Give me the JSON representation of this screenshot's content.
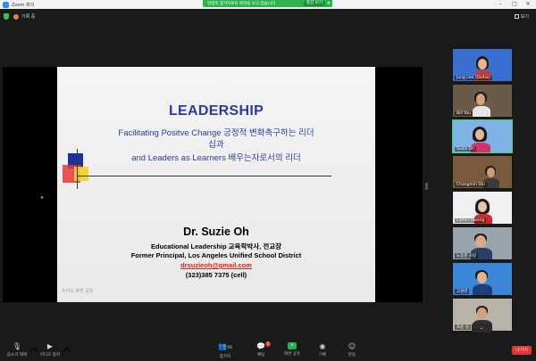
{
  "window": {
    "title": "Zoom 회의",
    "controls": [
      "–",
      "□",
      "✕"
    ]
  },
  "banner": {
    "text": "영업의 참가자로의 화면을 보고 있습니다",
    "button": "옵션 보기",
    "close": "✕"
  },
  "infobar": {
    "recording_label": "기록 중",
    "view_label": "보기"
  },
  "slide": {
    "title": "LEADERSHIP",
    "line1": "Facilitating Positve Change 긍정적 변화촉구하는 리더",
    "line2": "십과",
    "line3": "and Leaders as Learners 배우는자로서의 리더",
    "author": "Dr. Suzie Oh",
    "detail1": "Educational Leadership 교육학박사, 전교장",
    "detail2": "Former Principal, Los Angeles Unified School District",
    "email": "drsuzieoh@gmail.com",
    "phone": "(323)385 7375 (cell)",
    "presenter_tag": "수지오 화면 공유"
  },
  "gallery": {
    "tiles": [
      {
        "name": "Jung Lee (Dallas)",
        "active": false,
        "bg": "#3a6fd0",
        "skin": "#e9b48f",
        "hair": "#2a1a10",
        "shirt": "#c23a3a"
      },
      {
        "name": "Bill You",
        "active": false,
        "bg": "#6b5a4a",
        "skin": "#d8a27c",
        "hair": "#1e1e1e",
        "shirt": "#e6e6e6"
      },
      {
        "name": "Suzie Oh",
        "active": true,
        "bg": "#7fb3e6",
        "skin": "#e7b896",
        "hair": "#1a1a1a",
        "shirt": "#d6306a"
      },
      {
        "name": "Changmin Doi",
        "active": false,
        "bg": "#7a5a3c",
        "skin": "#cf9b76",
        "hair": "#202020",
        "shirt": "#3a3a3a"
      },
      {
        "name": "Esther Hwang",
        "active": false,
        "bg": "#f0f0f0",
        "skin": "#ecc3a3",
        "hair": "#1c1c1c",
        "shirt": "#d02a2a"
      },
      {
        "name": "노동준 사랑",
        "active": false,
        "bg": "#9aa3ad",
        "skin": "#d9aa86",
        "hair": "#1c1c1c",
        "shirt": "#2c3e66"
      },
      {
        "name": "고성란",
        "active": false,
        "bg": "#3c86d8",
        "skin": "#e3b291",
        "hair": "#1b1b1b",
        "shirt": "#1d3f7a"
      },
      {
        "name": "조윤 강",
        "active": false,
        "bg": "#b9b2a6",
        "skin": "#d3a07e",
        "hair": "#202020",
        "shirt": "#2f2f2f"
      }
    ],
    "more": "⌄"
  },
  "toolbar": {
    "mute": "음소거 해제",
    "video": "비디오 중지",
    "participants": "참가자",
    "participants_count": "40",
    "chat": "채팅",
    "chat_badge": "1",
    "share": "화면 공유",
    "record": "기록",
    "reactions": "반응",
    "leave": "나가기"
  }
}
